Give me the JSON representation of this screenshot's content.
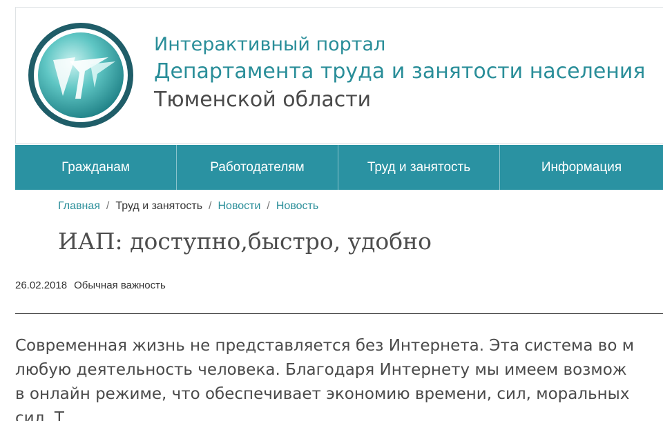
{
  "header": {
    "logo_icon": "portal-logo-icon",
    "title_line1": "Интерактивный портал",
    "title_line2": "Департамента труда и занятости населения",
    "title_line3": "Тюменской области"
  },
  "nav": {
    "items": [
      {
        "label": "Гражданам"
      },
      {
        "label": "Работодателям"
      },
      {
        "label": "Труд и занятость"
      },
      {
        "label": "Информация"
      }
    ]
  },
  "breadcrumb": {
    "items": [
      {
        "label": "Главная"
      },
      {
        "label": "Труд и занятость"
      },
      {
        "label": "Новости"
      },
      {
        "label": "Новость"
      }
    ],
    "separator": "/"
  },
  "article": {
    "title": "ИАП: доступно,быстро, удобно",
    "date": "26.02.2018",
    "importance": "Обычная важность",
    "lines": [
      "Современная жизнь не представляется без Интернета. Эта система во м",
      "любую деятельность человека. Благодаря Интернету мы имеем возмож",
      "в онлайн режиме, что обеспечивает экономию времени, сил, моральных",
      "сил. Т"
    ]
  },
  "colors": {
    "accent": "#2a92a2",
    "title_teal": "#2a8e99",
    "text": "#4a4a4a"
  }
}
